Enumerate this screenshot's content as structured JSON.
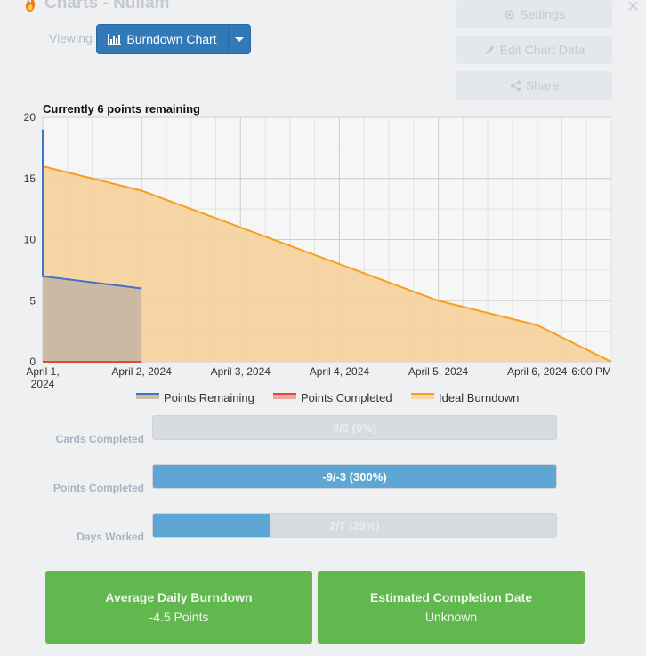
{
  "window": {
    "title": "Charts - Nullam",
    "close_symbol": "×"
  },
  "header": {
    "viewing_label": "Viewing",
    "chart_selector": {
      "selected": "Burndown Chart",
      "icon": "bar-chart-icon"
    }
  },
  "actions": [
    {
      "label": "Settings",
      "icon": "gear-icon"
    },
    {
      "label": "Edit Chart Data",
      "icon": "pencil-icon"
    },
    {
      "label": "Share",
      "icon": "share-icon"
    }
  ],
  "chart_data": {
    "type": "area",
    "title": "Currently 6 points remaining",
    "x_ticks": [
      "April 1, 2024",
      "April 2, 2024",
      "April 3, 2024",
      "April 4, 2024",
      "April 5, 2024",
      "April 6, 2024",
      "6:00 PM"
    ],
    "y_ticks": [
      "0",
      "5",
      "10",
      "15",
      "20"
    ],
    "ylim": [
      0,
      20
    ],
    "grid": true,
    "legend_position": "bottom",
    "series": [
      {
        "name": "Points Remaining",
        "color": "#4472c4",
        "fill": "#c8b7a3",
        "points": [
          [
            "April 1, 2024 00:00",
            19
          ],
          [
            "April 1, 2024 00:00",
            7
          ],
          [
            "April 2, 2024 00:00",
            6
          ]
        ]
      },
      {
        "name": "Points Completed",
        "color": "#e0483b",
        "fill": "#e8a197",
        "points": [
          [
            "April 1, 2024 00:00",
            0
          ],
          [
            "April 2, 2024 00:00",
            0
          ]
        ]
      },
      {
        "name": "Ideal Burndown",
        "color": "#f5a020",
        "fill": "#f5d3a0",
        "points": [
          [
            "April 1, 2024 00:00",
            16
          ],
          [
            "April 2, 2024 00:00",
            14
          ],
          [
            "April 3, 2024 00:00",
            11
          ],
          [
            "April 4, 2024 00:00",
            8
          ],
          [
            "April 5, 2024 00:00",
            5
          ],
          [
            "April 6, 2024 00:00",
            3
          ],
          [
            "April 6, 2024 18:00",
            0
          ]
        ]
      }
    ]
  },
  "stats": [
    {
      "label": "Cards Completed",
      "text": "0/6 (0%)",
      "fraction": 0
    },
    {
      "label": "Points Completed",
      "text": "-9/-3 (300%)",
      "fraction": 1
    },
    {
      "label": "Days Worked",
      "text": "2/7 (29%)",
      "fraction": 0.29
    }
  ],
  "summary": [
    {
      "title": "Average Daily Burndown",
      "value": "-4.5 Points"
    },
    {
      "title": "Estimated Completion Date",
      "value": "Unknown"
    }
  ],
  "colors": {
    "primary_button": "#3279b7",
    "progress_fill": "#5ea6d3",
    "summary_card": "#60b84f"
  }
}
